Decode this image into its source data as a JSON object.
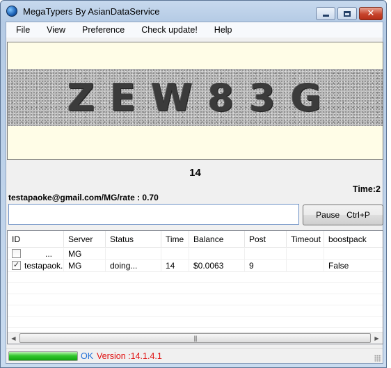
{
  "window": {
    "title": "MegaTypers By AsianDataService"
  },
  "menu": {
    "items": [
      "File",
      "View",
      "Preference",
      "Check update!",
      "Help"
    ]
  },
  "captcha": {
    "text": "ZEW83G"
  },
  "counter": "14",
  "time_label": "Time:2",
  "user_rate": "testapaoke@gmail.com/MG/rate : 0.70",
  "answer_input": {
    "value": "",
    "placeholder": ""
  },
  "pause_button": {
    "label": "Pause   Ctrl+P"
  },
  "table": {
    "columns": [
      "ID",
      "Server",
      "Status",
      "Time",
      "Balance",
      "Post",
      "Timeout",
      "boostpack"
    ],
    "rows": [
      {
        "checked": false,
        "id": "...",
        "server": "MG",
        "status": "",
        "time": "",
        "balance": "",
        "post": "",
        "timeout": "",
        "boostpack": ""
      },
      {
        "checked": true,
        "id": "testapaok...",
        "server": "MG",
        "status": "doing...",
        "time": "14",
        "balance": "$0.0063",
        "post": "9",
        "timeout": "",
        "boostpack": "False"
      }
    ]
  },
  "status": {
    "progress_fraction": 1.0,
    "ok_text": "OK",
    "version_text": "Version :14.1.4.1"
  },
  "colors": {
    "ok": "#1e6ed6",
    "version": "#e01010",
    "progress": "#2dbf28"
  }
}
